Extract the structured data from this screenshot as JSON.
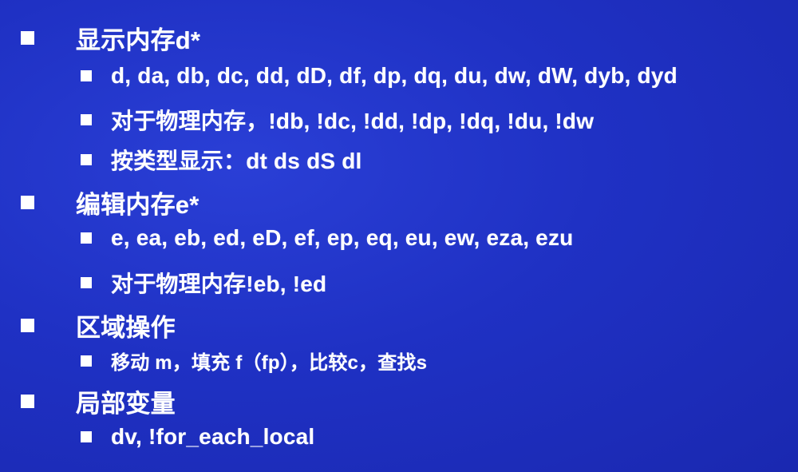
{
  "slide": {
    "items": [
      {
        "level": 1,
        "text": "显示内存d*"
      },
      {
        "level": 2,
        "text": "d, da, db, dc, dd, dD, df, dp, dq, du, dw, dW, dyb, dyd"
      },
      {
        "level": 2,
        "text": "对于物理内存，!db, !dc, !dd, !dp, !dq, !du, !dw"
      },
      {
        "level": 2,
        "text": "按类型显示：dt ds dS dl"
      },
      {
        "level": 1,
        "text": "编辑内存e*"
      },
      {
        "level": 2,
        "text": "e, ea, eb, ed, eD, ef, ep, eq, eu, ew, eza, ezu"
      },
      {
        "level": 2,
        "text": "对于物理内存!eb, !ed"
      },
      {
        "level": 1,
        "text": "区域操作"
      },
      {
        "level": 2,
        "text": "移动 m，填充 f（fp），比较c，查找s"
      },
      {
        "level": 1,
        "text": "局部变量"
      },
      {
        "level": 2,
        "text": "dv, !for_each_local"
      }
    ]
  }
}
